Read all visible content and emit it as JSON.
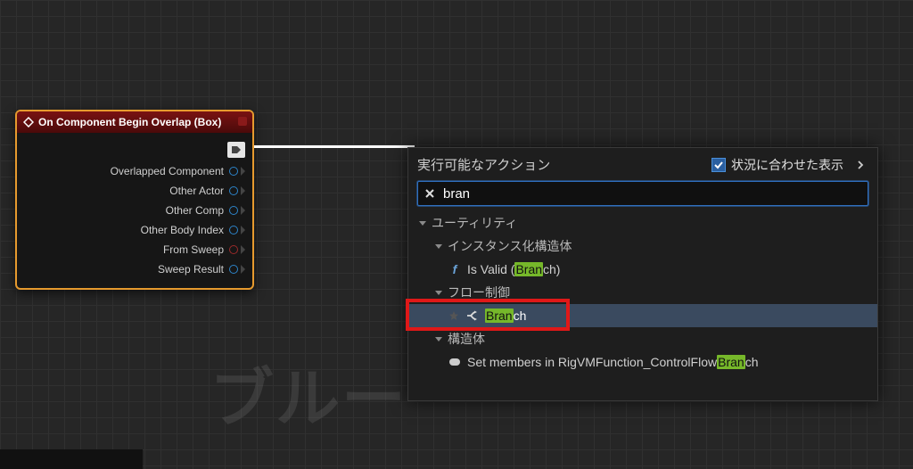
{
  "watermark": "ブルー",
  "bottom_strip": "",
  "node": {
    "title": "On Component Begin Overlap (Box)",
    "pins": [
      {
        "label": "Overlapped Component",
        "color": "blue"
      },
      {
        "label": "Other Actor",
        "color": "blue"
      },
      {
        "label": "Other Comp",
        "color": "blue"
      },
      {
        "label": "Other Body Index",
        "color": "blue"
      },
      {
        "label": "From Sweep",
        "color": "red"
      },
      {
        "label": "Sweep Result",
        "color": "blue"
      }
    ]
  },
  "context_menu": {
    "title": "実行可能なアクション",
    "context_sensitive_label": "状況に合わせた表示",
    "context_sensitive_checked": true,
    "search_value": "bran",
    "categories": {
      "utility": "ユーティリティ",
      "instanced_struct": "インスタンス化構造体",
      "flow_control": "フロー制御",
      "struct": "構造体"
    },
    "items": {
      "is_valid_pre": "Is Valid (",
      "is_valid_hl": "Bran",
      "is_valid_post": "ch)",
      "branch_hl": "Bran",
      "branch_post": "ch",
      "set_members_pre": "Set members in RigVMFunction_ControlFlow",
      "set_members_hl": "Bran",
      "set_members_post": "ch"
    }
  }
}
